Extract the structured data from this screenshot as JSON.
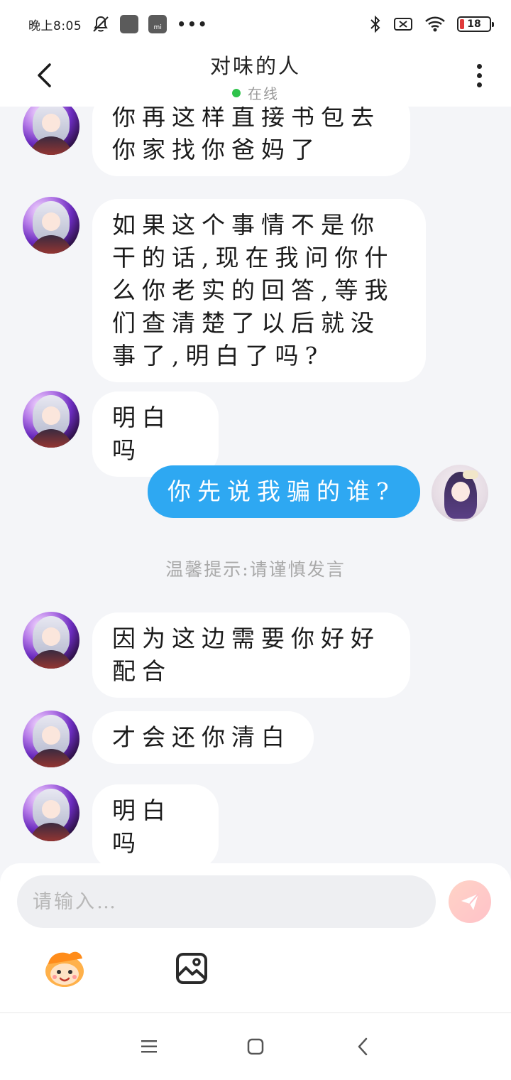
{
  "status_bar": {
    "time": "晚上8:05",
    "icons": [
      "mute-notification-icon",
      "app-icon",
      "mi-icon",
      "more-dots-icon",
      "bluetooth-icon",
      "no-sim-icon",
      "wifi-icon",
      "battery-icon"
    ],
    "mi_label": "mi",
    "more": "•••",
    "battery": "18"
  },
  "header": {
    "title": "对味的人",
    "status": "在线",
    "status_color": "#2fc34b"
  },
  "messages": [
    {
      "from": "peer",
      "text": "你再这样直接书包去\n你家找你爸妈了"
    },
    {
      "from": "peer",
      "text": "如果这个事情不是你\n干的话,现在我问你什\n么你老实的回答,等我\n们查清楚了以后就没\n事了,明白了吗?"
    },
    {
      "from": "peer",
      "text": "明白吗"
    },
    {
      "from": "me",
      "text": "你先说我骗的谁?"
    },
    {
      "from": "system",
      "text": "温馨提示:请谨慎发言"
    },
    {
      "from": "peer",
      "text": "因为这边需要你好好\n配合"
    },
    {
      "from": "peer",
      "text": "才会还你清白"
    },
    {
      "from": "peer",
      "text": "明白吗"
    }
  ],
  "composer": {
    "placeholder": "请输入…",
    "send_icon": "send-plane-icon",
    "tools": [
      "emoji-sticker-icon",
      "image-icon"
    ]
  },
  "nav": {
    "buttons": [
      "menu-icon",
      "home-icon",
      "back-icon"
    ]
  },
  "colors": {
    "my_bubble": "#2ea8f2",
    "peer_bubble": "#ffffff",
    "background": "#f4f5f8"
  }
}
